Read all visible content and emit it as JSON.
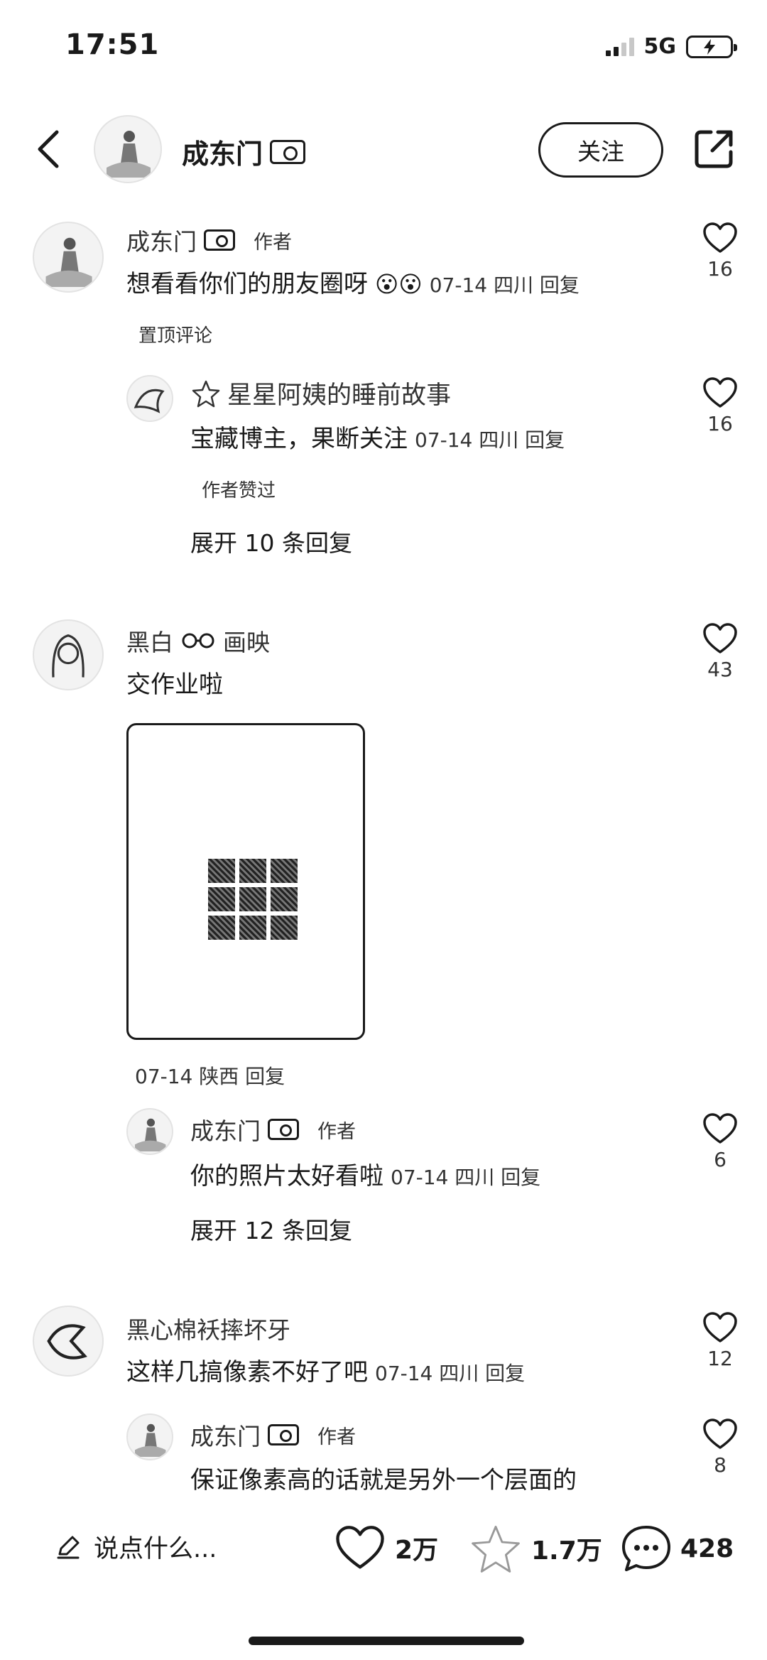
{
  "status": {
    "time": "17:51",
    "network": "5G"
  },
  "header": {
    "name": "成东门",
    "follow_label": "关注"
  },
  "comments": [
    {
      "name": "成东门",
      "author_tag": "作者",
      "text": "想看看你们的朋友圈呀",
      "meta": "07-14 四川 回复",
      "likes": "16",
      "pinned_label": "置顶评论",
      "reply": {
        "name": "星星阿姨的睡前故事",
        "text": "宝藏博主，果断关注",
        "meta": "07-14 四川 回复",
        "likes": "16",
        "liked_by_author": "作者赞过"
      },
      "expand": "展开 10 条回复"
    },
    {
      "name": "黑白",
      "name_suffix": "画映",
      "text": "交作业啦",
      "likes": "43",
      "meta": "07-14 陕西 回复",
      "reply": {
        "name": "成东门",
        "author_tag": "作者",
        "text": "你的照片太好看啦",
        "meta": "07-14 四川 回复",
        "likes": "6"
      },
      "expand": "展开 12 条回复"
    },
    {
      "name": "黑心棉袄摔坏牙",
      "text": "这样几搞像素不好了吧",
      "meta": "07-14 四川 回复",
      "likes": "12",
      "reply": {
        "name": "成东门",
        "author_tag": "作者",
        "text": "保证像素高的话就是另外一个层面的",
        "likes": "8"
      }
    }
  ],
  "bottom_bar": {
    "input_placeholder": "说点什么...",
    "likes": "2万",
    "favorites": "1.7万",
    "comments": "428"
  }
}
